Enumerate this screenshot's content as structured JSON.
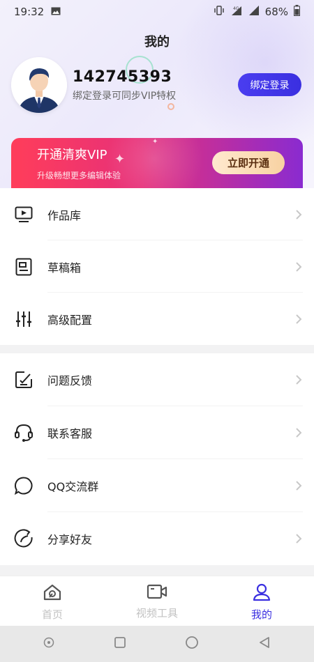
{
  "status_bar": {
    "time": "19:32",
    "battery": "68%"
  },
  "page": {
    "title": "我的"
  },
  "profile": {
    "user_id": "142745393",
    "bind_hint": "绑定登录可同步VIP特权",
    "bind_button": "绑定登录"
  },
  "vip": {
    "title": "开通清爽VIP",
    "subtitle": "升级畅想更多编辑体验",
    "button": "立即开通"
  },
  "menu_group_1": [
    {
      "label": "作品库",
      "icon": "video-library-icon"
    },
    {
      "label": "草稿箱",
      "icon": "drafts-icon"
    },
    {
      "label": "高级配置",
      "icon": "sliders-icon"
    }
  ],
  "menu_group_2": [
    {
      "label": "问题反馈",
      "icon": "feedback-icon"
    },
    {
      "label": "联系客服",
      "icon": "headset-icon"
    },
    {
      "label": "QQ交流群",
      "icon": "chat-bubble-icon"
    },
    {
      "label": "分享好友",
      "icon": "share-icon"
    }
  ],
  "tabbar": [
    {
      "label": "首页",
      "icon": "home-icon",
      "active": false
    },
    {
      "label": "视频工具",
      "icon": "video-camera-icon",
      "active": false
    },
    {
      "label": "我的",
      "icon": "user-icon",
      "active": true
    }
  ],
  "colors": {
    "accent": "#3a2fe0",
    "vip_start": "#ff3d5a",
    "vip_end": "#8a2bd0",
    "vip_button": "#f8d2a2"
  }
}
